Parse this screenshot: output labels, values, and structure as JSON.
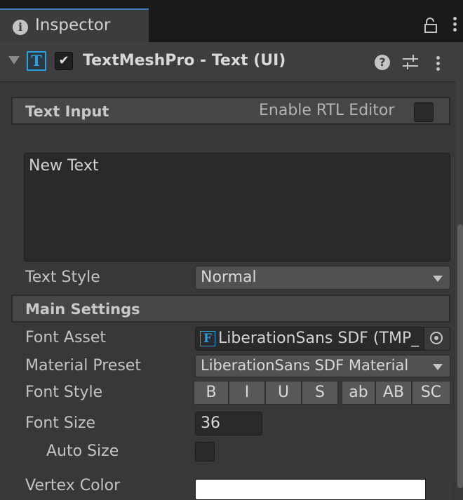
{
  "tab": {
    "label": "Inspector"
  },
  "component": {
    "title": "TextMeshPro - Text (UI)",
    "enabled": true
  },
  "text_input": {
    "section_title": "Text Input",
    "rtl_label": "Enable RTL Editor",
    "rtl_enabled": false,
    "value": "New Text"
  },
  "text_style": {
    "label": "Text Style",
    "value": "Normal"
  },
  "main_settings": {
    "section_title": "Main Settings",
    "font_asset": {
      "label": "Font Asset",
      "value": "LiberationSans SDF (TMP_"
    },
    "material_preset": {
      "label": "Material Preset",
      "value": "LiberationSans SDF Material"
    },
    "font_style": {
      "label": "Font Style",
      "buttons": [
        "B",
        "I",
        "U",
        "S",
        "ab",
        "AB",
        "SC"
      ]
    },
    "font_size": {
      "label": "Font Size",
      "value": "36"
    },
    "auto_size": {
      "label": "Auto Size",
      "checked": false
    },
    "vertex_color": {
      "label": "Vertex Color",
      "color": "#ffffff"
    }
  },
  "colors": {
    "accent": "#3a79bb",
    "icon_blue": "#2ba0e0",
    "panel": "#383838"
  }
}
